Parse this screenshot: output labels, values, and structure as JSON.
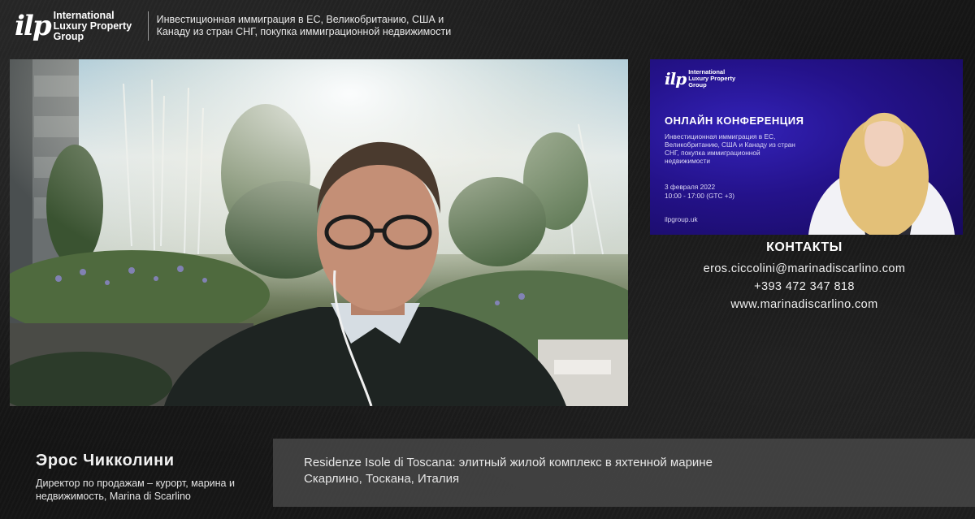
{
  "header": {
    "logo_mark": "ilp",
    "logo_text": "International Luxury Property Group",
    "tagline": "Инвестиционная иммиграция в ЕС, Великобританию, США и Канаду из стран СНГ, покупка иммиграционной недвижимости"
  },
  "conference_card": {
    "logo_mark": "ilp",
    "logo_text": "International Luxury Property Group",
    "title": "ОНЛАЙН КОНФЕРЕНЦИЯ",
    "description": "Инвестиционная иммиграция в ЕС, Великобританию, США и Канаду из стран СНГ, покупка иммиграционной недвижимости",
    "date": "3 февраля 2022",
    "time": "10:00 - 17:00 (GTC +3)",
    "website": "ilpgroup.uk"
  },
  "contacts": {
    "title": "КОНТАКТЫ",
    "email": "eros.ciccolini@marinadiscarlino.com",
    "phone": "+393 472 347 818",
    "website": "www.marinadiscarlino.com"
  },
  "speaker": {
    "name": "Эрос Чикколини",
    "role": "Директор по продажам – курорт, марина и недвижимость, Marina di Scarlino"
  },
  "topic": {
    "text": "Residenze Isole di Toscana: элитный жилой комплекс в яхтенной марине Скарлино, Тоскана, Италия"
  },
  "colors": {
    "background": "#1a1a1a",
    "card_blue": "#24128a",
    "topic_bar": "#464646"
  }
}
